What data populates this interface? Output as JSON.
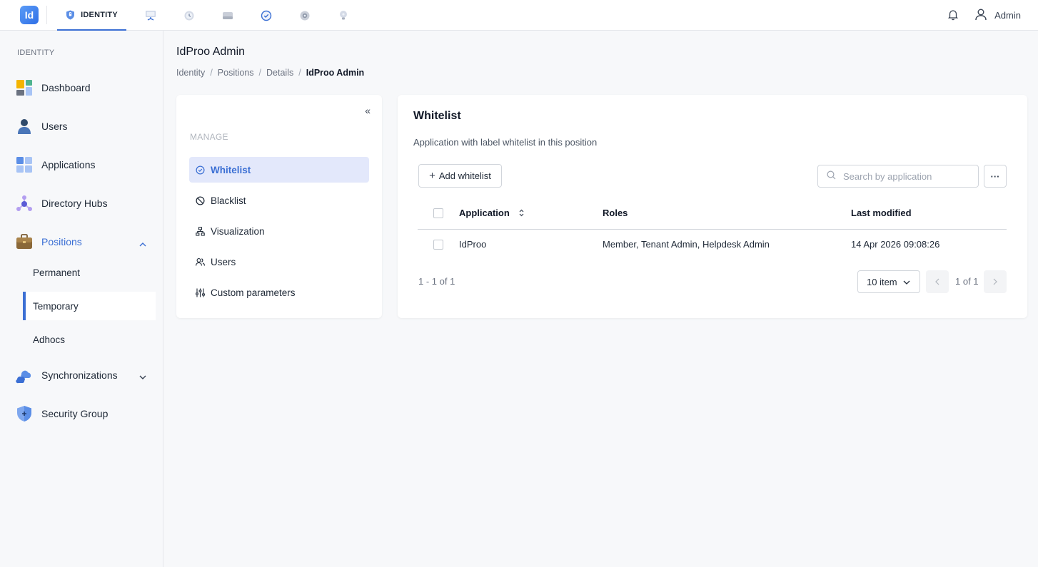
{
  "topbar": {
    "logo_text": "Id",
    "tabs": [
      {
        "label": "IDENTITY",
        "icon": "shield-icon",
        "active": true
      },
      {
        "label": "",
        "icon": "monitor-icon"
      },
      {
        "label": "",
        "icon": "history-icon"
      },
      {
        "label": "",
        "icon": "drive-icon"
      },
      {
        "label": "",
        "icon": "check-circle-icon"
      },
      {
        "label": "",
        "icon": "gear-icon"
      },
      {
        "label": "",
        "icon": "lightbulb-icon"
      }
    ],
    "user_label": "Admin"
  },
  "sidebar": {
    "section": "IDENTITY",
    "items": [
      {
        "label": "Dashboard",
        "icon": "dashboard-icon"
      },
      {
        "label": "Users",
        "icon": "user-icon"
      },
      {
        "label": "Applications",
        "icon": "apps-icon"
      },
      {
        "label": "Directory Hubs",
        "icon": "hub-icon"
      },
      {
        "label": "Positions",
        "icon": "briefcase-icon",
        "active": true,
        "expanded": true
      },
      {
        "label": "Synchronizations",
        "icon": "cloud-sync-icon"
      },
      {
        "label": "Security Group",
        "icon": "shield-plus-icon"
      }
    ],
    "subitems": [
      {
        "label": "Permanent"
      },
      {
        "label": "Temporary",
        "active": true
      },
      {
        "label": "Adhocs"
      }
    ]
  },
  "page": {
    "title": "IdProo Admin",
    "breadcrumbs": [
      "Identity",
      "Positions",
      "Details",
      "IdProo Admin"
    ]
  },
  "manage_panel": {
    "collapse_label": "«",
    "section": "MANAGE",
    "items": [
      {
        "label": "Whitelist",
        "icon": "check-circle-icon",
        "active": true
      },
      {
        "label": "Blacklist",
        "icon": "ban-icon"
      },
      {
        "label": "Visualization",
        "icon": "hierarchy-icon"
      },
      {
        "label": "Users",
        "icon": "users-icon"
      },
      {
        "label": "Custom parameters",
        "icon": "sliders-icon"
      }
    ]
  },
  "whitelist": {
    "title": "Whitelist",
    "description": "Application with label whitelist in this position",
    "add_button": "Add whitelist",
    "search_placeholder": "Search by application",
    "more_button": "···",
    "columns": [
      "Application",
      "Roles",
      "Last modified"
    ],
    "rows": [
      {
        "application": "IdProo",
        "roles": "Member, Tenant Admin, Helpdesk Admin",
        "last_modified": "14 Apr 2026 09:08:26"
      }
    ],
    "pagination": {
      "count_text": "1 - 1 of 1",
      "page_size": "10 item",
      "page_text": "1 of 1"
    }
  },
  "colors": {
    "accent": "#3b6fd4",
    "active_bg": "#e3e8fb"
  }
}
